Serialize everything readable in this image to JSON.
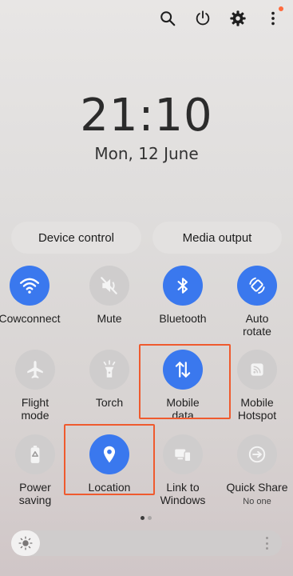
{
  "colors": {
    "accent": "#3a78ee",
    "highlight": "#ef5a2e",
    "notification_dot": "#ff6a3d"
  },
  "top_icons": [
    "search-icon",
    "power-icon",
    "gear-icon",
    "more-vert-icon"
  ],
  "clock": {
    "time": "21:10",
    "date": "Mon, 12 June"
  },
  "buttons": {
    "device_control": "Device control",
    "media_output": "Media output"
  },
  "tiles": [
    {
      "label": "Cowconnect",
      "icon": "wifi-icon",
      "active": true
    },
    {
      "label": "Mute",
      "icon": "mute-icon",
      "active": false
    },
    {
      "label": "Bluetooth",
      "icon": "bluetooth-icon",
      "active": true
    },
    {
      "label": "Auto\nrotate",
      "icon": "rotate-icon",
      "active": true
    },
    {
      "label": "Flight\nmode",
      "icon": "airplane-icon",
      "active": false
    },
    {
      "label": "Torch",
      "icon": "torch-icon",
      "active": false
    },
    {
      "label": "Mobile\ndata",
      "icon": "mobile-data-icon",
      "active": true,
      "highlighted": true
    },
    {
      "label": "Mobile\nHotspot",
      "icon": "hotspot-icon",
      "active": false
    },
    {
      "label": "Power\nsaving",
      "icon": "battery-icon",
      "active": false
    },
    {
      "label": "Location",
      "icon": "location-icon",
      "active": true,
      "highlighted": true
    },
    {
      "label": "Link to\nWindows",
      "icon": "link-windows-icon",
      "active": false
    },
    {
      "label": "Quick Share",
      "sublabel": "No one",
      "icon": "quick-share-icon",
      "active": false
    }
  ],
  "pager": {
    "pages": 2,
    "current": 1
  },
  "brightness": {
    "icon": "sun-icon"
  }
}
